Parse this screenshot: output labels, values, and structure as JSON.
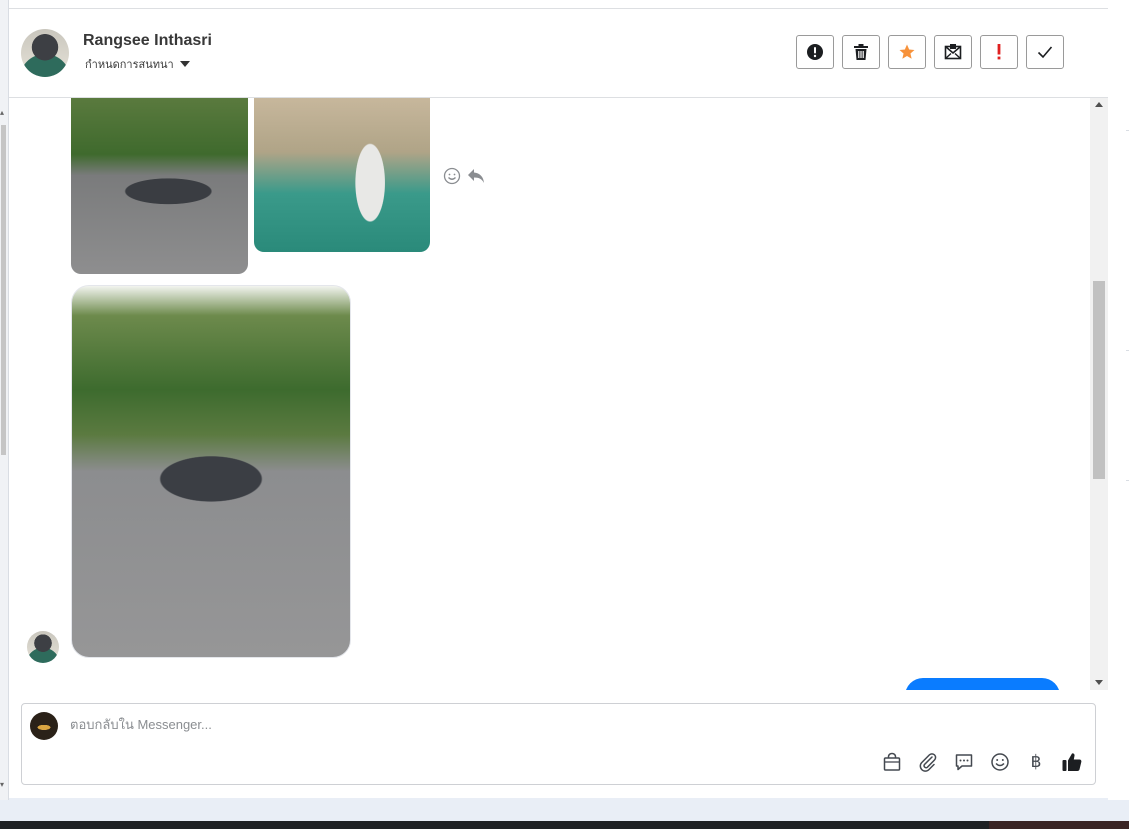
{
  "header": {
    "contact_name": "Rangsee Inthasri",
    "chat_setting_label": "กำหนดการสนทนา",
    "actions": [
      {
        "name": "report-button",
        "icon": "exclamation-circle-icon"
      },
      {
        "name": "delete-button",
        "icon": "trash-icon"
      },
      {
        "name": "star-button",
        "icon": "star-icon",
        "color": "#f7923b"
      },
      {
        "name": "mark-unread-button",
        "icon": "envelope-icon"
      },
      {
        "name": "important-button",
        "icon": "exclamation-icon",
        "color": "#e02020"
      },
      {
        "name": "done-button",
        "icon": "check-icon"
      }
    ]
  },
  "conversation": {
    "messages": [
      {
        "type": "photos",
        "photos": [
          "car-photo",
          "person-at-lake-photo"
        ]
      },
      {
        "type": "photo",
        "photos": [
          "car-photo"
        ]
      },
      {
        "type": "outgoing-text",
        "color": "#0a7cff"
      }
    ]
  },
  "composer": {
    "placeholder": "ตอบกลับใน Messenger...",
    "tools": [
      "shopping-bag-icon",
      "paperclip-icon",
      "saved-reply-icon",
      "emoji-icon",
      "baht-icon",
      "thumbs-up-icon"
    ],
    "baht_symbol": "฿"
  }
}
